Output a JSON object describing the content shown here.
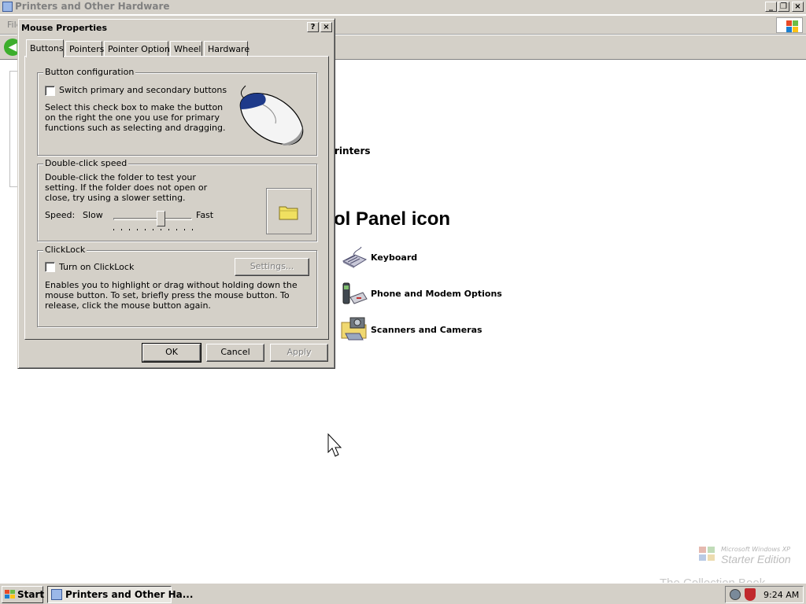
{
  "explorer": {
    "title": "Printers and Other Hardware",
    "menu_partial": "File",
    "back_label": "Back",
    "printers_link_partial": "rinters",
    "heading_partial": "ol Panel icon",
    "items": [
      {
        "label": "Keyboard",
        "icon": "keyboard-icon"
      },
      {
        "label": "Phone and Modem Options",
        "icon": "phone-icon"
      },
      {
        "label": "Scanners and Cameras",
        "icon": "scanner-icon"
      }
    ]
  },
  "dialog": {
    "title": "Mouse Properties",
    "help_label": "?",
    "close_label": "×",
    "tabs": [
      "Buttons",
      "Pointers",
      "Pointer Options",
      "Wheel",
      "Hardware"
    ],
    "active_tab": 0,
    "button_config": {
      "legend": "Button configuration",
      "checkbox_label": "Switch primary and secondary buttons",
      "checked": false,
      "description": "Select this check box to make the button on the right the one you use for primary functions such as selecting and dragging."
    },
    "double_click": {
      "legend": "Double-click speed",
      "description": "Double-click the folder to test your setting. If the folder does not open or close, try using a slower setting.",
      "speed_label": "Speed:",
      "slow_label": "Slow",
      "fast_label": "Fast",
      "slider_value": 0.6,
      "test_icon": "folder-icon"
    },
    "clicklock": {
      "legend": "ClickLock",
      "checkbox_label": "Turn on ClickLock",
      "checked": false,
      "settings_label": "Settings...",
      "description": "Enables you to highlight or drag without holding down the mouse button. To set, briefly press the mouse button. To release, click the mouse button again."
    },
    "buttons": {
      "ok": "OK",
      "cancel": "Cancel",
      "apply": "Apply"
    }
  },
  "watermark": {
    "small": "Microsoft Windows XP",
    "big": "Starter Edition",
    "collection": "The Collection Book"
  },
  "taskbar": {
    "start_label": "Start",
    "task_label": "Printers and Other Ha...",
    "clock": "9:24 AM"
  },
  "colors": {
    "dialog_face": "#d4d0c8",
    "start_green": "#3cae2c",
    "folder_yellow": "#f0e060"
  }
}
